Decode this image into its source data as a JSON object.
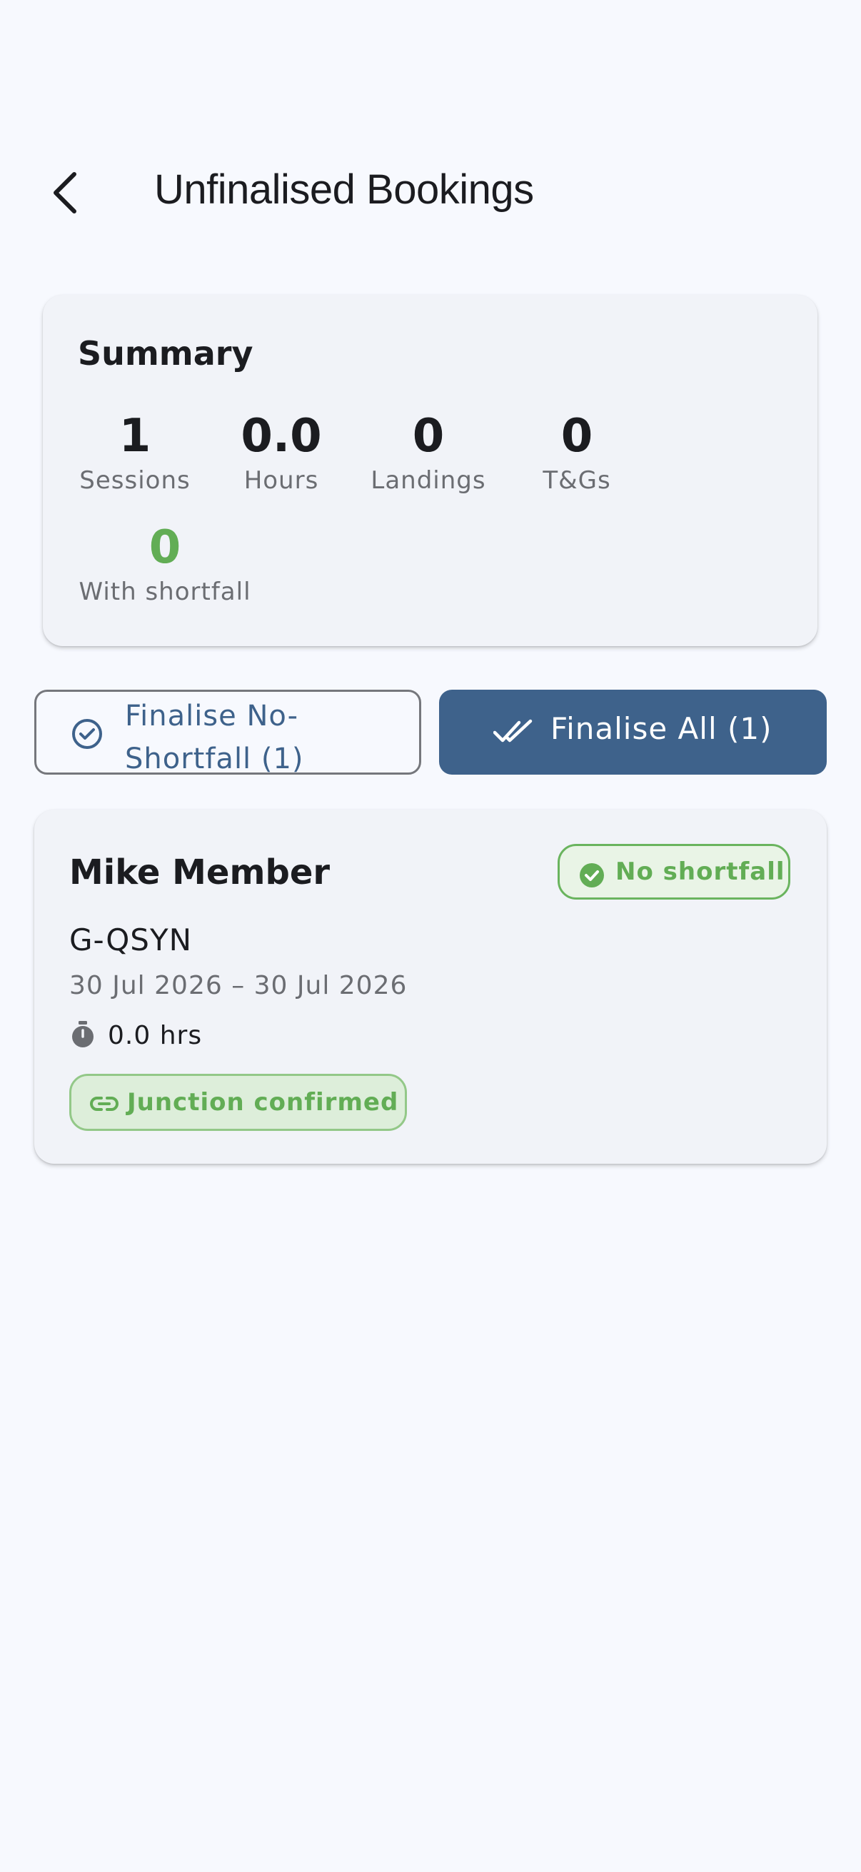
{
  "header": {
    "title": "Unfinalised Bookings",
    "back_icon": "chevron-left-icon"
  },
  "summary": {
    "title": "Summary",
    "stats": [
      {
        "value": "1",
        "label": "Sessions"
      },
      {
        "value": "0.0",
        "label": "Hours"
      },
      {
        "value": "0",
        "label": "Landings"
      },
      {
        "value": "0",
        "label": "T&Gs"
      },
      {
        "value": "0",
        "label": "With shortfall"
      }
    ]
  },
  "actions": {
    "finalise_no_shortfall": "Finalise No-Shortfall (1)",
    "finalise_all": "Finalise All (1)"
  },
  "bookings": [
    {
      "member": "Mike Member",
      "status_chip": "No shortfall",
      "aircraft": "G-QSYN",
      "dates": "30 Jul 2026 – 30 Jul 2026",
      "hours": "0.0 hrs",
      "junction_chip": "Junction confirmed"
    }
  ],
  "colors": {
    "primary": "#3e628b",
    "success": "#62ad55",
    "background": "#f7f9fe",
    "card": "#f1f3f8"
  }
}
